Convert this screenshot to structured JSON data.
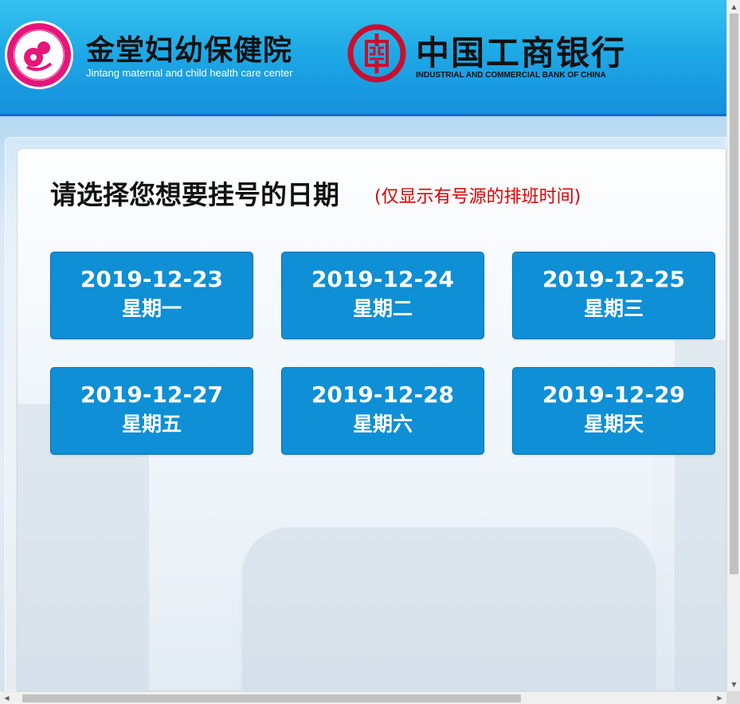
{
  "header": {
    "hospital_name": "金堂妇幼保健院",
    "hospital_name_en": "Jintang maternal and child health care center",
    "bank_name": "中国工商银行",
    "bank_name_en": "INDUSTRIAL AND COMMERCIAL BANK OF CHINA"
  },
  "main": {
    "title": "请选择您想要挂号的日期",
    "subtitle": "(仅显示有号源的排班时间)",
    "dates": [
      {
        "date": "2019-12-23",
        "weekday": "星期一"
      },
      {
        "date": "2019-12-24",
        "weekday": "星期二"
      },
      {
        "date": "2019-12-25",
        "weekday": "星期三"
      },
      {
        "date": "2019-12-27",
        "weekday": "星期五"
      },
      {
        "date": "2019-12-28",
        "weekday": "星期六"
      },
      {
        "date": "2019-12-29",
        "weekday": "星期天"
      }
    ]
  },
  "colors": {
    "header_blue": "#1ea9e6",
    "button_blue": "#0e8fd6",
    "subtitle_red": "#e00000",
    "hospital_pink": "#e6157a",
    "icbc_red": "#c8102e"
  }
}
